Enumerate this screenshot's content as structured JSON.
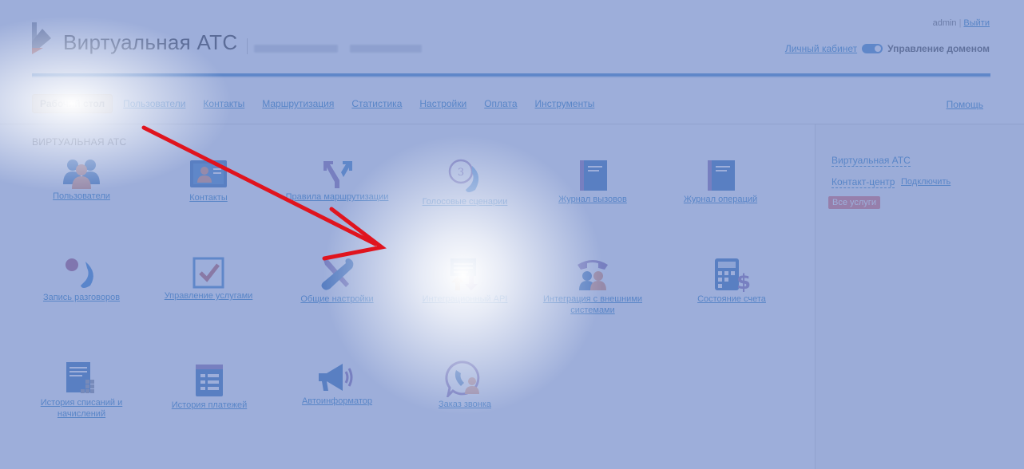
{
  "header": {
    "app_title": "Виртуальная АТС",
    "user": "admin",
    "logout": "Выйти",
    "cabinet_link": "Личный кабинет",
    "domain_label": "Управление доменом"
  },
  "nav": {
    "active": "Рабочий стол",
    "items": [
      "Пользователи",
      "Контакты",
      "Маршрутизация",
      "Статистика",
      "Настройки",
      "Оплата",
      "Инструменты"
    ],
    "help": "Помощь"
  },
  "main": {
    "section_title": "ВИРТУАЛЬНАЯ АТС",
    "tiles": [
      {
        "label": "Пользователи",
        "icon": "users-icon"
      },
      {
        "label": "Контакты",
        "icon": "contacts-card-icon"
      },
      {
        "label": "Правила маршрутизации",
        "icon": "routing-arrows-icon"
      },
      {
        "label": "Голосовые сценарии",
        "icon": "voice-scenario-icon"
      },
      {
        "label": "Журнал вызовов",
        "icon": "call-log-book-icon"
      },
      {
        "label": "Журнал операций",
        "icon": "operations-log-book-icon"
      },
      {
        "label": "Запись разговоров",
        "icon": "call-recording-icon"
      },
      {
        "label": "Управление услугами",
        "icon": "checkbox-icon"
      },
      {
        "label": "Общие настройки",
        "icon": "wrench-screwdriver-icon"
      },
      {
        "label": "Интеграционный API",
        "icon": "api-upload-download-icon"
      },
      {
        "label": "Интеграция с внешними системами",
        "icon": "telephone-users-icon"
      },
      {
        "label": "Состояние счета",
        "icon": "calculator-dollar-icon"
      },
      {
        "label": "История списаний и начислений",
        "icon": "charges-history-icon"
      },
      {
        "label": "История платежей",
        "icon": "payments-history-icon"
      },
      {
        "label": "Автоинформатор",
        "icon": "megaphone-icon"
      },
      {
        "label": "Заказ звонка",
        "icon": "callback-order-icon"
      }
    ],
    "step_badge": "3"
  },
  "sidebar": {
    "vats_link": "Виртуальная АТС",
    "contact_center_link": "Контакт-центр",
    "connect_link": "Подключить",
    "all_services": "Все услуги"
  },
  "colors": {
    "accent_blue": "#3f86c9",
    "link_blue": "#2a7fc4",
    "active_tab_bg": "#fde3b4",
    "highlight_arrow": "#e0141e"
  }
}
